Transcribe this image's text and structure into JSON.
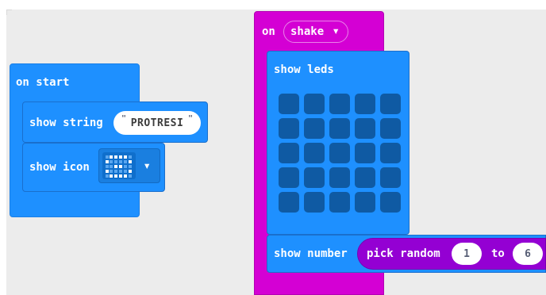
{
  "on_start": {
    "header": "on start",
    "show_string_label": "show string",
    "show_string_value": "PROTRESI",
    "show_icon_label": "show icon",
    "icon_dropdown": "▾"
  },
  "on_shake": {
    "on_label": "on",
    "event": "shake",
    "event_dropdown": "▾",
    "show_leds_label": "show leds",
    "show_number_label": "show number",
    "pick_random_label": "pick random",
    "random_from": "1",
    "random_to_label": "to",
    "random_to": "6"
  },
  "colors": {
    "basic_blue": "#1e90ff",
    "input_magenta": "#d400d4",
    "math_purple": "#9400d3",
    "led_off": "#0f5aa3"
  },
  "icons": [
    "quote-icon",
    "led-icon-preview",
    "dropdown-arrow-icon"
  ]
}
